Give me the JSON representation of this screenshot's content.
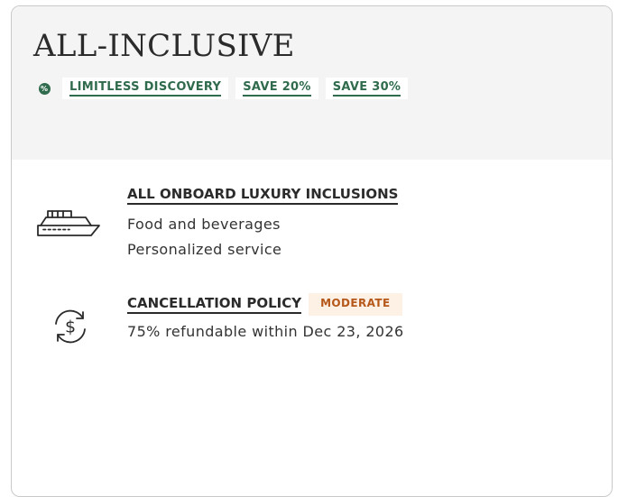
{
  "header": {
    "title": "ALL-INCLUSIVE",
    "tags": [
      "LIMITLESS DISCOVERY",
      "SAVE 20%",
      "SAVE 30%"
    ],
    "tag_icon_symbol": "%",
    "tag_icon": "percent-icon"
  },
  "inclusions": {
    "title": "ALL ONBOARD LUXURY INCLUSIONS",
    "icon": "ship-icon",
    "items": [
      "Food and beverages",
      "Personalized service"
    ]
  },
  "cancellation": {
    "title": "CANCELLATION POLICY",
    "badge": "MODERATE",
    "icon": "refund-dollar-icon",
    "details": "75% refundable within Dec 23, 2026"
  },
  "colors": {
    "accent_green": "#2f6b4c",
    "badge_text": "#b5581a",
    "badge_bg": "#fdf1e6",
    "header_bg": "#f4f4f4"
  }
}
